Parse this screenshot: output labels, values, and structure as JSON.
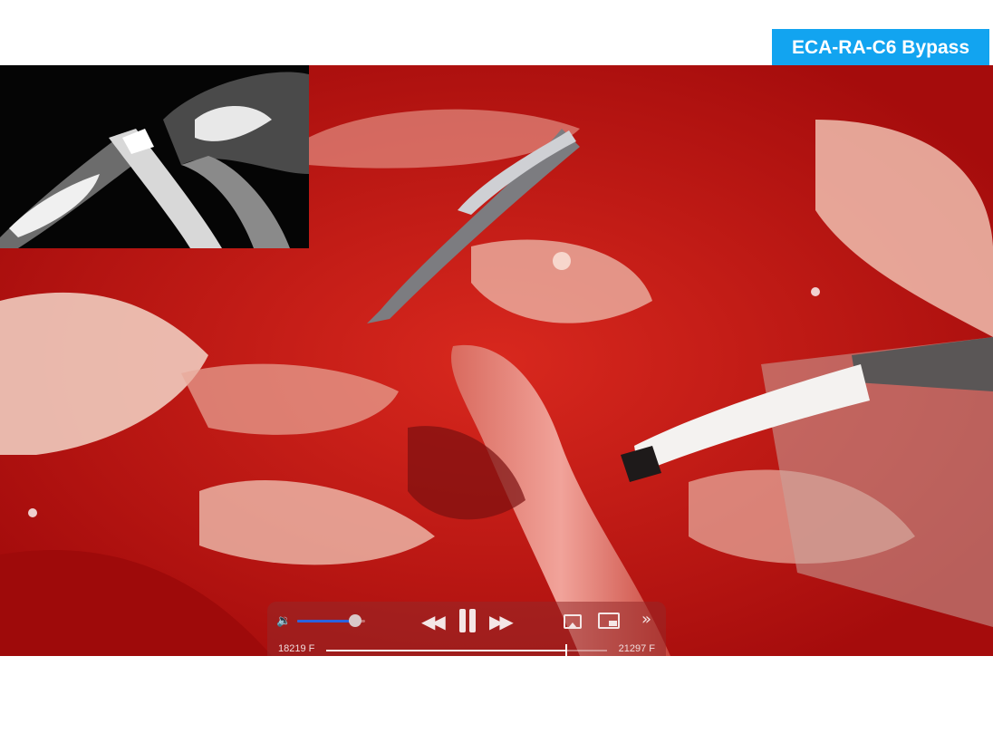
{
  "title_badge": "ECA-RA-C6 Bypass",
  "colors": {
    "badge": "#12a4f0",
    "volume_fill": "#2a62e0"
  },
  "player": {
    "volume_level": 0.85,
    "time_start": "18219 F",
    "time_end": "21297 F",
    "progress": 0.85,
    "icons": [
      "speaker-icon",
      "rewind-icon",
      "pause-icon",
      "fast-forward-icon",
      "airplay-icon",
      "pip-icon",
      "more-icon"
    ]
  }
}
